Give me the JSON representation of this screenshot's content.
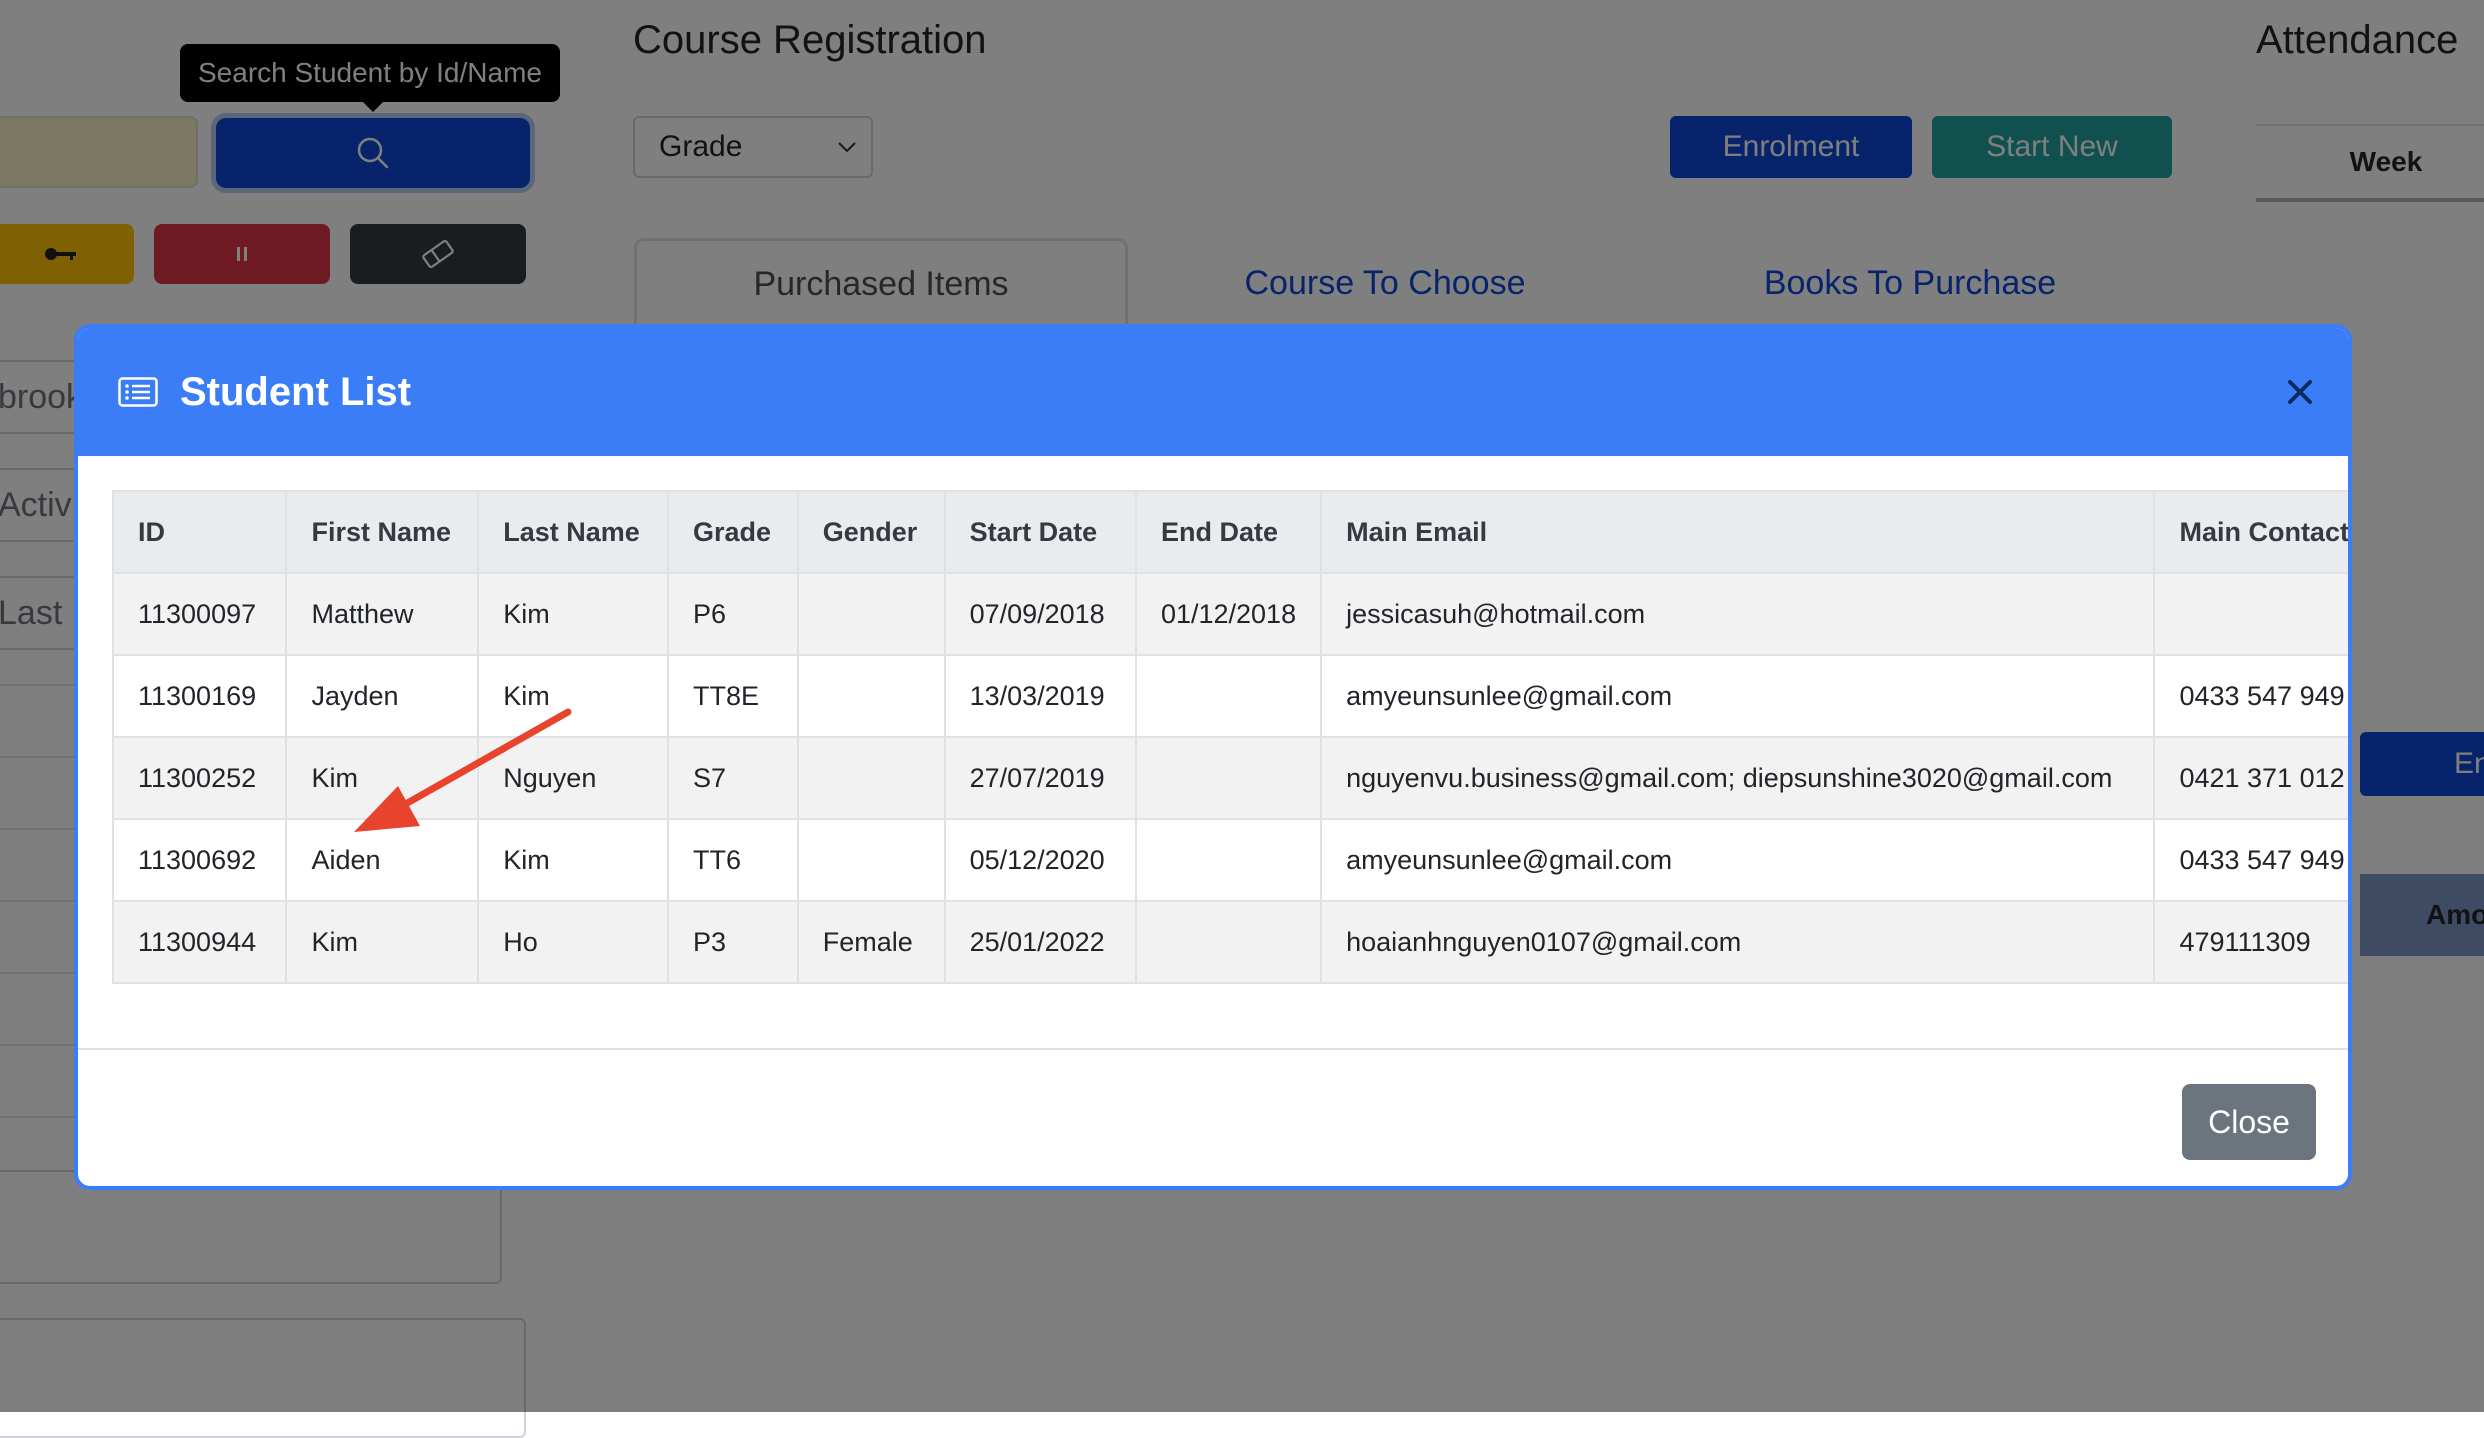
{
  "tooltip": {
    "text": "Search Student by Id/Name"
  },
  "sidebar": {
    "field_1": "brook",
    "field_2": "Activ",
    "field_3": "Last N"
  },
  "course_registration": {
    "title": "Course Registration",
    "grade_select": {
      "value": "Grade"
    },
    "enrolment_label": "Enrolment",
    "start_new_label": "Start New",
    "tabs": [
      {
        "label": "Purchased Items",
        "active": true
      },
      {
        "label": "Course To Choose",
        "active": false
      },
      {
        "label": "Books To Purchase",
        "active": false
      }
    ]
  },
  "attendance": {
    "title": "Attendance",
    "week_header": "Week",
    "en_button": "En",
    "amount_header": "Amo"
  },
  "modal": {
    "title": "Student List",
    "close_label": "Close",
    "columns": [
      "ID",
      "First Name",
      "Last Name",
      "Grade",
      "Gender",
      "Start Date",
      "End Date",
      "Main Email",
      "Main Contact"
    ],
    "rows": [
      {
        "id": "11300097",
        "first": "Matthew",
        "last": "Kim",
        "grade": "P6",
        "gender": "",
        "start": "07/09/2018",
        "end": "01/12/2018",
        "email": "jessicasuh@hotmail.com",
        "contact": ""
      },
      {
        "id": "11300169",
        "first": "Jayden",
        "last": "Kim",
        "grade": "TT8E",
        "gender": "",
        "start": "13/03/2019",
        "end": "",
        "email": "amyeunsunlee@gmail.com",
        "contact": "0433 547 949"
      },
      {
        "id": "11300252",
        "first": "Kim",
        "last": "Nguyen",
        "grade": "S7",
        "gender": "",
        "start": "27/07/2019",
        "end": "",
        "email": "nguyenvu.business@gmail.com; diepsunshine3020@gmail.com",
        "contact": "0421 371 012"
      },
      {
        "id": "11300692",
        "first": "Aiden",
        "last": "Kim",
        "grade": "TT6",
        "gender": "",
        "start": "05/12/2020",
        "end": "",
        "email": "amyeunsunlee@gmail.com",
        "contact": "0433 547 949"
      },
      {
        "id": "11300944",
        "first": "Kim",
        "last": "Ho",
        "grade": "P3",
        "gender": "Female",
        "start": "25/01/2022",
        "end": "",
        "email": "hoaianhnguyen0107@gmail.com",
        "contact": "479111309"
      }
    ]
  },
  "colors": {
    "modal_header": "#3b7cf7",
    "primary_button": "#0d47d9",
    "start_new_button": "#20a3a0",
    "annotation_arrow": "#e8432c"
  }
}
